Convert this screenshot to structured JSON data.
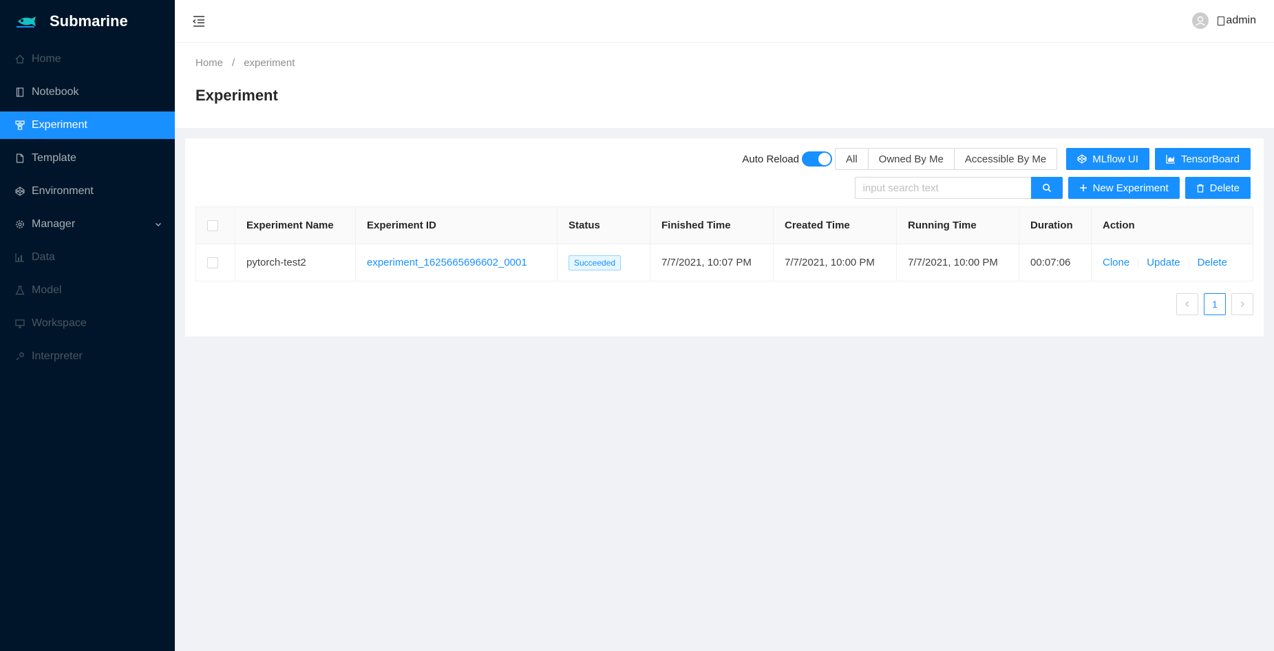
{
  "app": {
    "name": "Submarine",
    "logo_caption": "Submarine"
  },
  "sidebar": {
    "items": [
      {
        "label": "Home",
        "icon": "home-icon",
        "state": "disabled"
      },
      {
        "label": "Notebook",
        "icon": "book-icon",
        "state": "normal"
      },
      {
        "label": "Experiment",
        "icon": "experiment-icon",
        "state": "active"
      },
      {
        "label": "Template",
        "icon": "file-icon",
        "state": "normal"
      },
      {
        "label": "Environment",
        "icon": "codepen-icon",
        "state": "normal"
      },
      {
        "label": "Manager",
        "icon": "gear-icon",
        "state": "normal",
        "has_submenu": true
      },
      {
        "label": "Data",
        "icon": "bar-chart-icon",
        "state": "disabled"
      },
      {
        "label": "Model",
        "icon": "flask-icon",
        "state": "disabled"
      },
      {
        "label": "Workspace",
        "icon": "desktop-icon",
        "state": "disabled"
      },
      {
        "label": "Interpreter",
        "icon": "api-icon",
        "state": "disabled"
      }
    ]
  },
  "header": {
    "user_name": "admin"
  },
  "breadcrumb": {
    "home": "Home",
    "separator": "/",
    "current": "experiment"
  },
  "page": {
    "title": "Experiment"
  },
  "toolbar": {
    "auto_reload_label": "Auto Reload",
    "auto_reload_on": true,
    "filters": [
      "All",
      "Owned By Me",
      "Accessible By Me"
    ],
    "mlflow_label": "MLflow UI",
    "tensorboard_label": "TensorBoard",
    "search_placeholder": "input search text",
    "new_experiment_label": "New Experiment",
    "delete_label": "Delete"
  },
  "table": {
    "headers": [
      "Experiment Name",
      "Experiment ID",
      "Status",
      "Finished Time",
      "Created Time",
      "Running Time",
      "Duration",
      "Action"
    ],
    "rows": [
      {
        "name": "pytorch-test2",
        "id": "experiment_1625665696602_0001",
        "status": "Succeeded",
        "finished_time": "7/7/2021, 10:07 PM",
        "created_time": "7/7/2021, 10:00 PM",
        "running_time": "7/7/2021, 10:00 PM",
        "duration": "00:07:06",
        "actions": [
          "Clone",
          "Update",
          "Delete"
        ]
      }
    ]
  },
  "pagination": {
    "current_page": "1"
  },
  "colors": {
    "primary": "#1890ff",
    "sidebar_bg": "#001529",
    "page_bg": "#f0f2f5"
  }
}
